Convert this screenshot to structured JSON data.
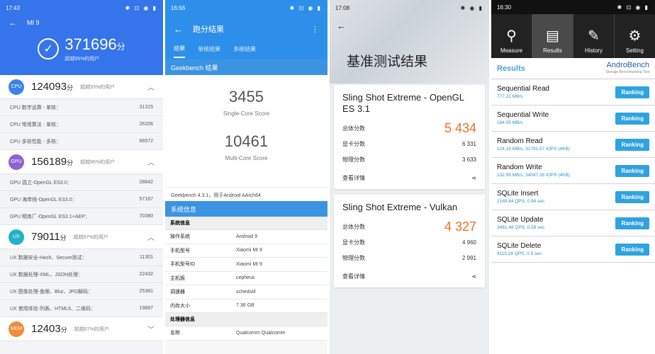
{
  "antutu": {
    "time": "17:43",
    "title": "MI 9",
    "total": "371696",
    "total_unit": "分",
    "total_sub": "超越95%的用户",
    "categories": [
      {
        "badge": "CPU",
        "color": "#3c83e8",
        "score": "124093",
        "unit": "分",
        "pct": "超越93%的用户",
        "chev": "^",
        "items": [
          [
            "CPU 数学运算 - 单核：",
            "31315"
          ],
          [
            "CPU 常用算法 - 单核：",
            "26206"
          ],
          [
            "CPU 多核性能 - 多核：",
            "66572"
          ]
        ]
      },
      {
        "badge": "GPU",
        "color": "#8c64d4",
        "score": "156189",
        "unit": "分",
        "pct": "超越96%的用户",
        "chev": "^",
        "items": [
          [
            "GPU 孤立-OpenGL ES3.0：",
            "28642"
          ],
          [
            "GPU 海岸线-OpenGL ES3.0：",
            "57167"
          ],
          [
            "GPU 精炼厂-OpenGL ES3.1+AEP：",
            "70380"
          ]
        ]
      },
      {
        "badge": "UX",
        "color": "#23b0c8",
        "score": "79011",
        "unit": "分",
        "pct": "超越97%的用户",
        "chev": "^",
        "items": [
          [
            "UX 数据安全-Hash、Secure测试：",
            "11301"
          ],
          [
            "UX 数据处理-XML、JSON处理：",
            "22432"
          ],
          [
            "UX 图像处理-鱼眼、Blur、JPG解码：",
            "25381"
          ],
          [
            "UX 使用体验-列表、HTML5、二维码：",
            "19897"
          ]
        ]
      },
      {
        "badge": "MEM",
        "color": "#f28a3a",
        "score": "12403",
        "unit": "分",
        "pct": "超越67%的用户",
        "chev": "v",
        "items": []
      }
    ]
  },
  "geekbench": {
    "time": "16:56",
    "title": "跑分结果",
    "tabs": [
      "结果",
      "单核结果",
      "多核结果"
    ],
    "section": "Geekbench 结果",
    "single": "3455",
    "single_label": "Single-Core Score",
    "multi": "10461",
    "multi_label": "Multi-Core Score",
    "note": "Geekbench 4.3.1，用于Android AArch64",
    "sysinfo": "系统信息",
    "sys_head": "系统信息",
    "rows": [
      [
        "操作系统",
        "Android 9"
      ],
      [
        "手机型号",
        "Xiaomi MI 9"
      ],
      [
        "手机型号ID",
        "Xiaomi MI 9"
      ],
      [
        "主机板",
        "cepheus"
      ],
      [
        "调速器",
        "schedutil"
      ],
      [
        "内存大小",
        "7.36 GB"
      ]
    ],
    "cpu_head": "处理器信息",
    "cpu_rows": [
      [
        "名称",
        "Qualcomm Qualcomm"
      ]
    ]
  },
  "threedmark": {
    "time": "17:08",
    "title": "基准测试结果",
    "cards": [
      {
        "title": "Sling Shot Extreme - OpenGL ES 3.1",
        "total_label": "总体分数",
        "total": "5 434",
        "rows": [
          [
            "显卡分数",
            "6 331"
          ],
          [
            "物理分数",
            "3 633"
          ]
        ],
        "detail": "查看详情"
      },
      {
        "title": "Sling Shot Extreme - Vulkan",
        "total_label": "总体分数",
        "total": "4 327",
        "rows": [
          [
            "显卡分数",
            "4 960"
          ],
          [
            "物理分数",
            "2 991"
          ]
        ],
        "detail": "查看详情"
      }
    ]
  },
  "androbench": {
    "time": "16:30",
    "tabs": [
      "Measure",
      "Results",
      "History",
      "Setting"
    ],
    "results_title": "Results",
    "logo": "AndroBench",
    "logo_sub": "Storage Benchmarking Tool",
    "button": "Ranking",
    "rows": [
      [
        "Sequential Read",
        "777.21 MB/s"
      ],
      [
        "Sequential Write",
        "194.05 MB/s"
      ],
      [
        "Random Read",
        "124.18 MB/s, 31791.57 IOPS (4KB)"
      ],
      [
        "Random Write",
        "132.99 MB/s, 34047.35 IOPS (4KB)"
      ],
      [
        "SQLite Insert",
        "2169.84 QPS, 0.94 sec"
      ],
      [
        "SQLite Update",
        "3481.48 QPS, 0.58 sec"
      ],
      [
        "SQLite Delete",
        "4110.28 QPS, 0.5 sec"
      ]
    ]
  }
}
